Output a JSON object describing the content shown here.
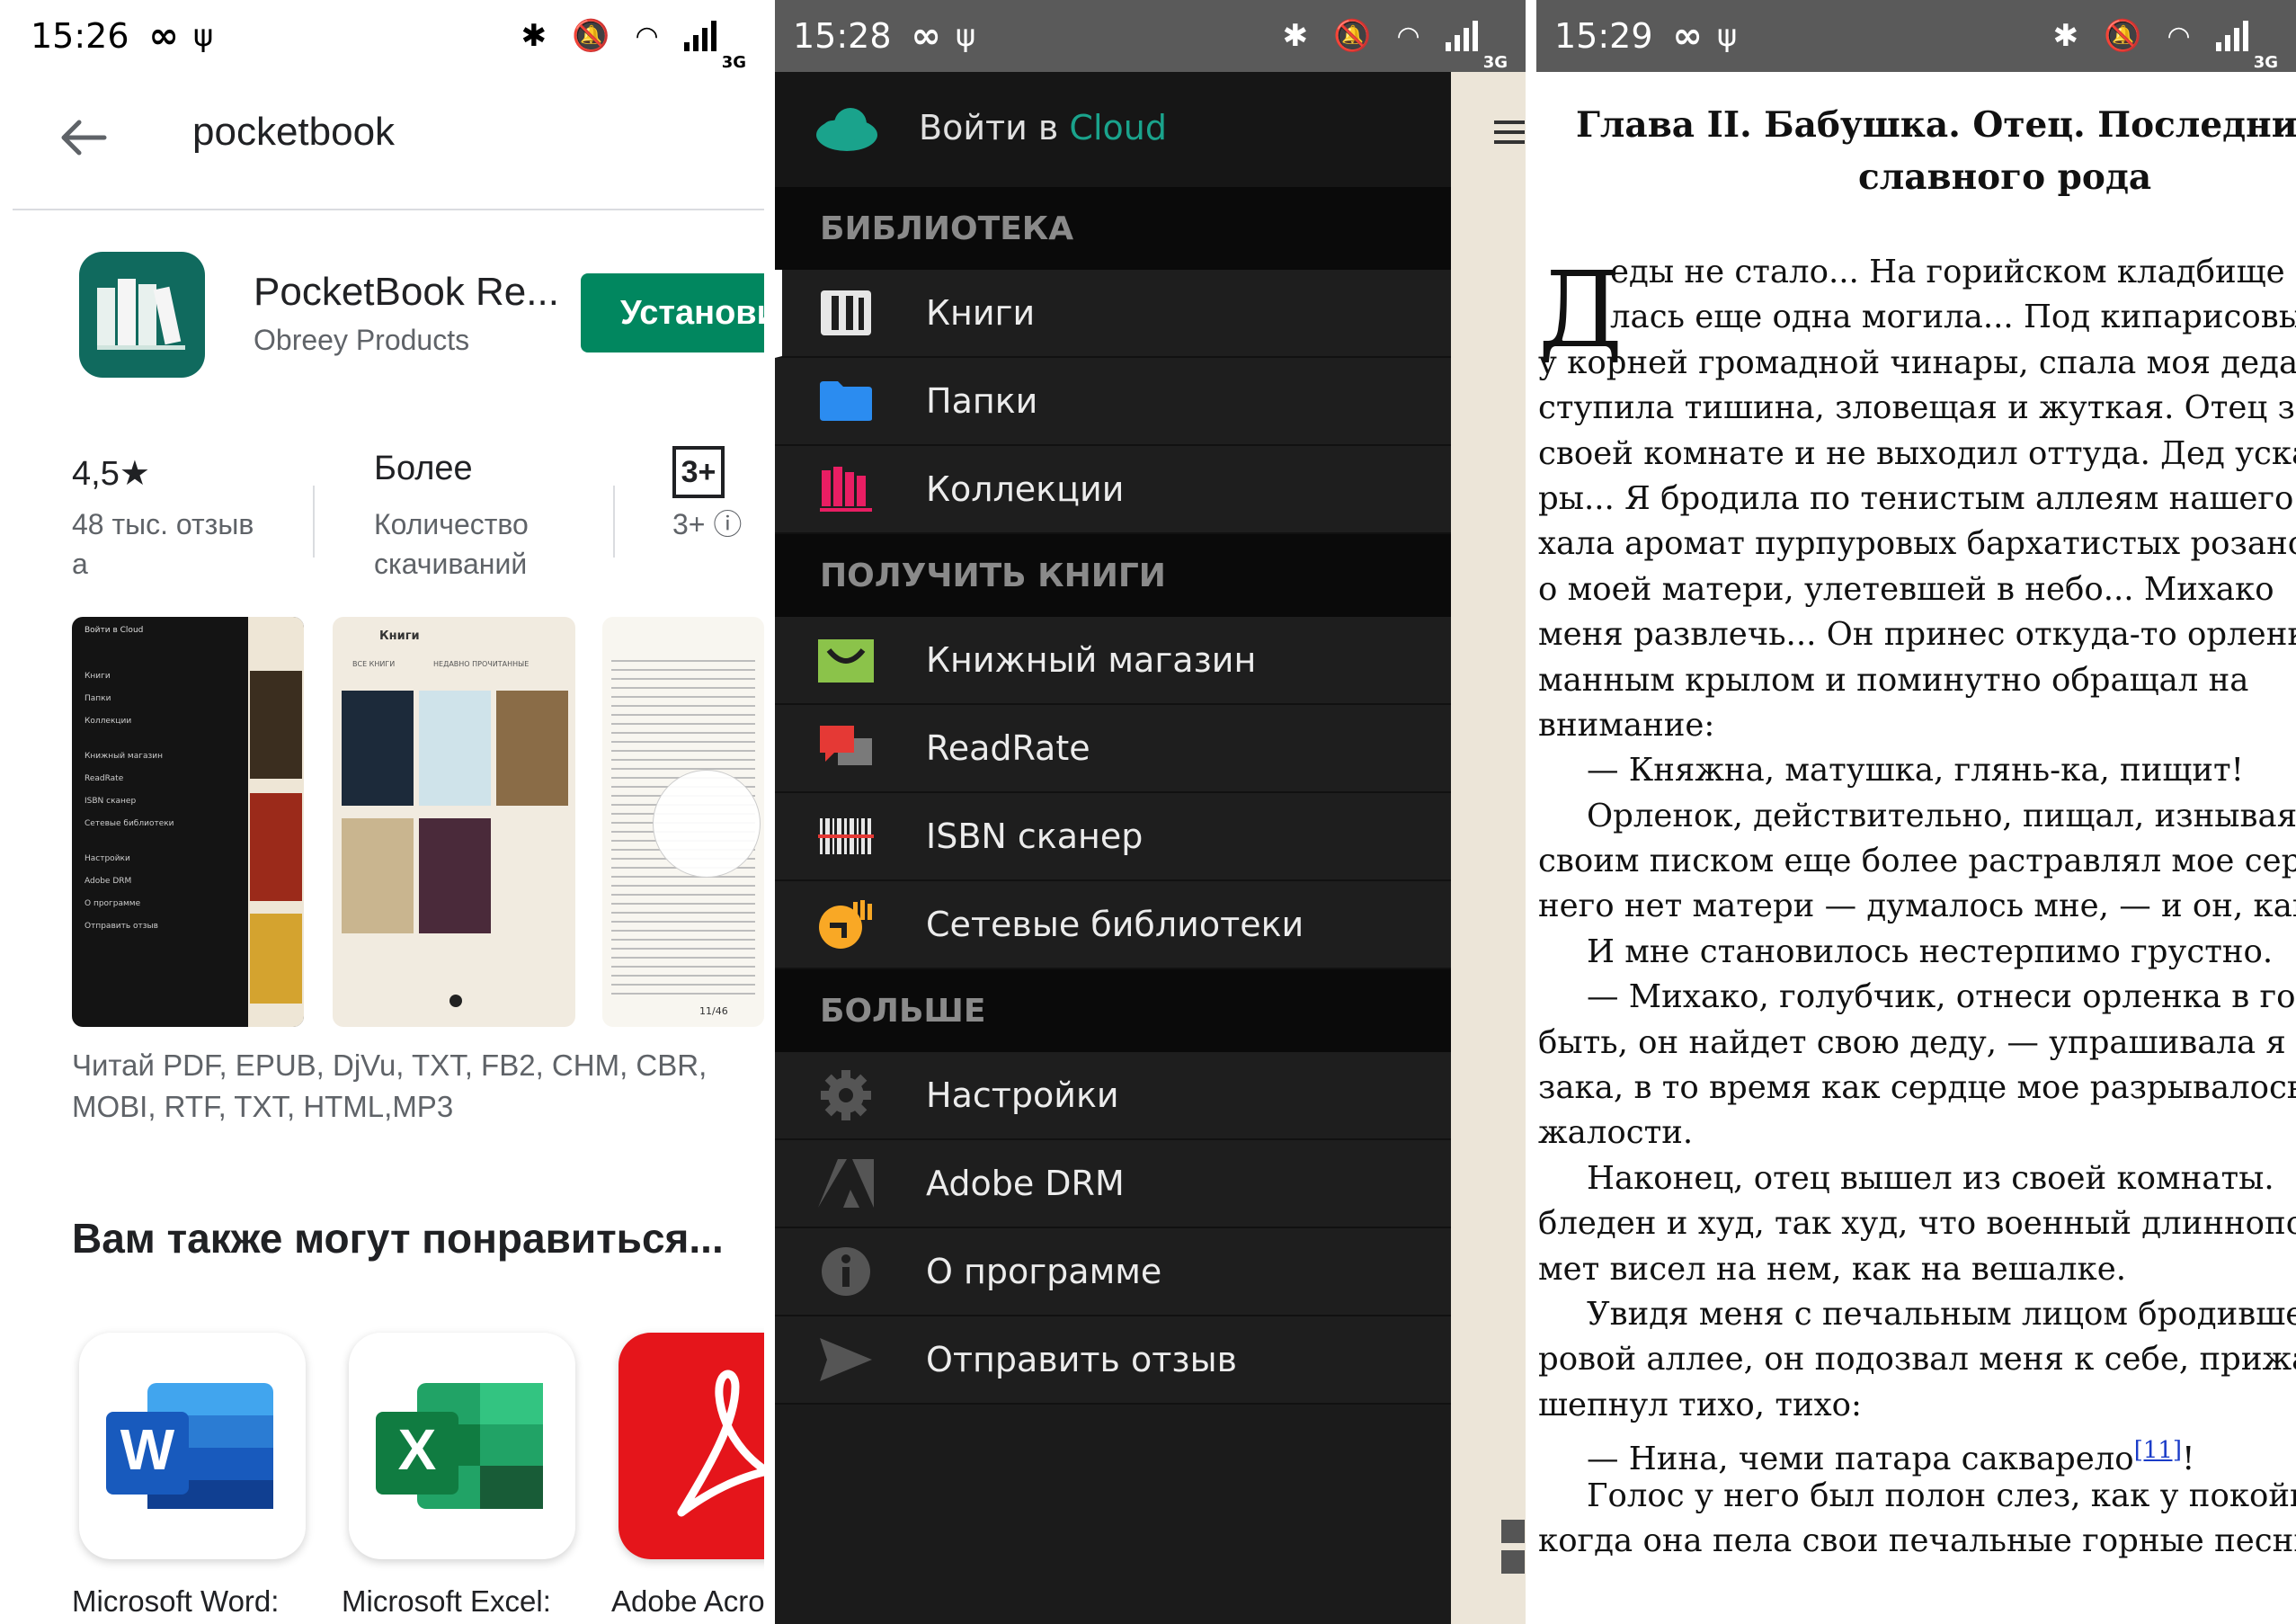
{
  "status_bars": [
    {
      "time": "15:26",
      "net": "3G"
    },
    {
      "time": "15:28",
      "net": "3G"
    },
    {
      "time": "15:29",
      "net": "3G"
    }
  ],
  "play_store": {
    "search_query": "pocketbook",
    "app": {
      "title": "PocketBook Re...",
      "developer": "Obreey Products",
      "install_label": "Установить"
    },
    "stats": {
      "rating": "4,5★",
      "reviews_line1": "48 тыс. отзыв",
      "reviews_line2": "а",
      "downloads": "Более",
      "downloads_line1": "Количество",
      "downloads_line2": "скачиваний",
      "age_badge": "3+",
      "age_label": "3+ ⓘ"
    },
    "screenshot_texts": {
      "s1_header": "Войти в Cloud",
      "s1_items": [
        "Книги",
        "Папки",
        "Коллекции",
        "Книжный магазин",
        "ReadRate",
        "ISBN сканер",
        "Сетевые библиотеки",
        "Настройки",
        "Adobe DRM",
        "О программе",
        "Отправить отзыв"
      ],
      "s2_title": "Книги",
      "s2_tabs": [
        "ВСЕ КНИГИ",
        "НЕДАВНО ПРОЧИТАННЫЕ"
      ],
      "s3_page": "11/46"
    },
    "description": "Читай PDF, EPUB, DjVu, TXT, FB2, CHM, CBR, MOBI, RTF, TXT, HTML,MP3",
    "recommend_title": "Вам также могут понравиться...",
    "recommendations": [
      {
        "label": "Microsoft Word:",
        "color": "#185abd"
      },
      {
        "label": "Microsoft Excel:",
        "color": "#107c41"
      },
      {
        "label": "Adobe Acrobat",
        "color": "#e5151b"
      }
    ]
  },
  "drawer": {
    "cloud_prefix": "Войти в ",
    "cloud_word": "Cloud",
    "sections": {
      "library": "БИБЛИОТЕКА",
      "get_books": "ПОЛУЧИТЬ КНИГИ",
      "more": "БОЛЬШЕ"
    },
    "library_items": [
      "Книги",
      "Папки",
      "Коллекции"
    ],
    "get_items": [
      "Книжный магазин",
      "ReadRate",
      "ISBN сканер",
      "Сетевые библиотеки"
    ],
    "more_items": [
      "Настройки",
      "Adobe DRM",
      "О программе",
      "Отправить отзыв"
    ],
    "colors": {
      "cloud": "#1aa38c",
      "folder": "#2b8cf0",
      "collections": "#e91e63",
      "store": "#8bc34a",
      "readrate": "#e53935",
      "network": "#f9a825"
    }
  },
  "reader": {
    "chapter_line1": "Глава II. Бабушка. Отец. Последний от",
    "chapter_line2": "славного рода",
    "dropcap": "Д",
    "lines": [
      "еды не стало... На горийском кладбище",
      "лась еще одна могила... Под кипарисовым",
      "у корней громадной чинары, спала моя деда! В",
      "ступила тишина, зловещая и жуткая. Отец з",
      "своей комнате и не выходил оттуда. Дед уска",
      "ры... Я бродила по тенистым аллеям нашего с",
      "хала аромат пурпуровых бархатистых розанов",
      "о моей матери, улетевшей в небо... Михако",
      "меня развлечь... Он принес откуда-то орленк",
      "манным крылом и поминутно обращал на",
      "внимание:",
      "— Княжна, матушка, глянь-ка, пищит!",
      "Орленок, действительно, пищал, изнывая в",
      "своим писком еще более растравлял мое сердце",
      "него нет матери — думалось мне, — и он, как я!",
      "И мне становилось нестерпимо грустно.",
      "— Михако, голубчик, отнеси орленка в гор",
      "быть, он найдет свою деду, — упрашивала я ст",
      "зака, в то время как сердце мое разрывалось о",
      "жалости.",
      "Наконец, отец вышел из своей комнаты.",
      "бледен и худ, так худ, что военный длиннопо",
      "мет висел на нем, как на вешалке.",
      "Увидя меня с печальным лицом бродившей",
      "ровой аллее, он подозвал меня к себе, прижал",
      "шепнул тихо, тихо:",
      "— Нина, чеми патара сакварело",
      "Голос у него был полон слез, как у покойн",
      "когда она пела свои печальные горные песни."
    ],
    "footnote": "[11]",
    "footnote_after": "!"
  }
}
